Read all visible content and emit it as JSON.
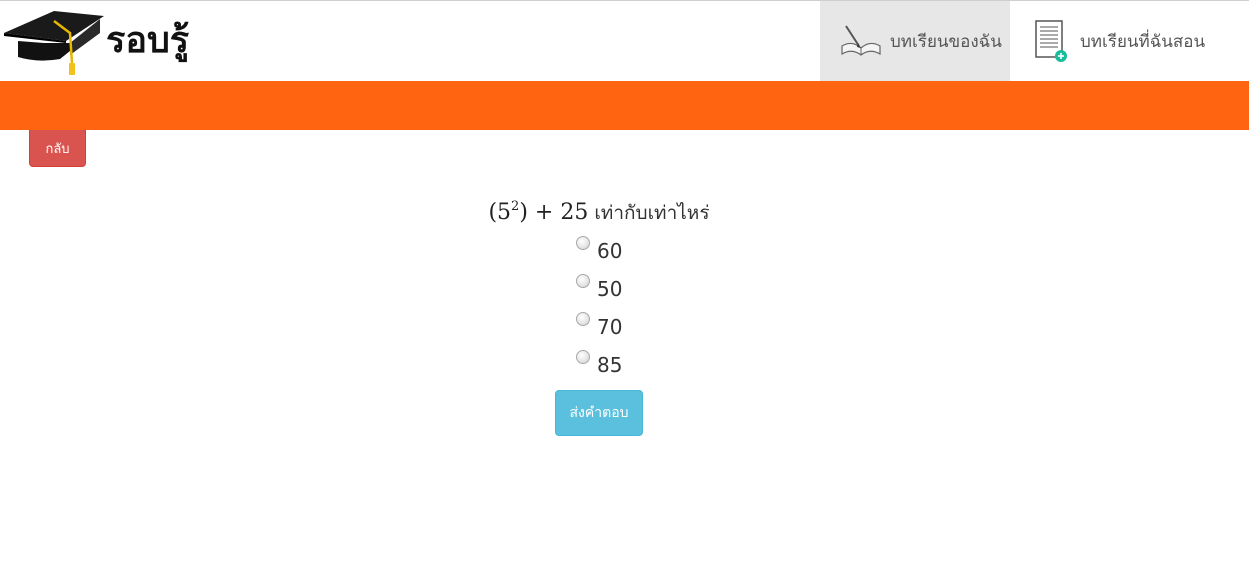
{
  "brand": {
    "name": "รอบรู้",
    "logo_icon": "graduation-cap-icon"
  },
  "nav": {
    "items": [
      {
        "label": "บทเรียนของฉัน",
        "icon": "open-book-icon",
        "active": true
      },
      {
        "label": "บทเรียนที่ฉันสอน",
        "icon": "document-add-icon",
        "active": false
      }
    ]
  },
  "colors": {
    "orange_bar": "#ff6410",
    "back_button": "#d9534f",
    "submit_button": "#5bc0de",
    "active_nav": "#e7e7e7"
  },
  "back_button": {
    "label": "กลับ"
  },
  "question": {
    "math_base": "5",
    "math_exponent": "2",
    "math_rest": "+ 25",
    "text": "เท่ากับเท่าไหร่"
  },
  "options": [
    {
      "label": "60"
    },
    {
      "label": "50"
    },
    {
      "label": "70"
    },
    {
      "label": "85"
    }
  ],
  "submit_button": {
    "label": "ส่งคำตอบ"
  }
}
